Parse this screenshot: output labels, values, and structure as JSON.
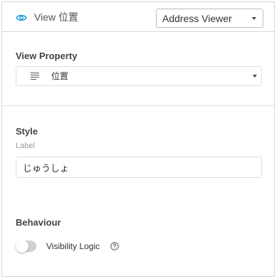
{
  "header": {
    "title": "View 位置",
    "viewer_select": "Address Viewer",
    "eye_icon": "eye-icon",
    "accent": "#1a9ad6"
  },
  "view_property": {
    "title": "View Property",
    "value": "位置",
    "icon": "list-icon"
  },
  "style": {
    "title": "Style",
    "label_caption": "Label",
    "label_value": "じゅうしょ"
  },
  "behaviour": {
    "title": "Behaviour",
    "toggle_label": "Visibility Logic",
    "toggle_on": false,
    "help_icon": "help-icon"
  }
}
